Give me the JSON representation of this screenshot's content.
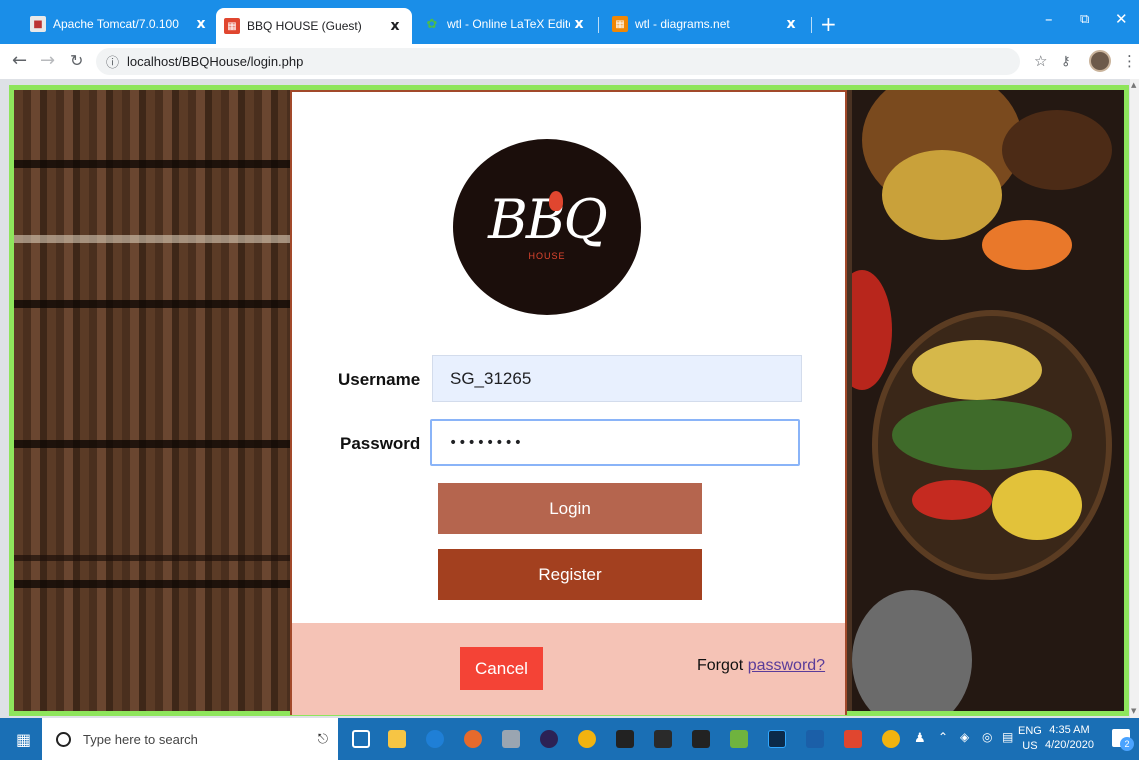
{
  "browser": {
    "tabs": [
      {
        "title": "Apache Tomcat/7.0.100",
        "favicon": "tomcat-icon",
        "active": false
      },
      {
        "title": "BBQ HOUSE (Guest)",
        "favicon": "bbq-icon",
        "active": true
      },
      {
        "title": "wtl - Online LaTeX Editor Overleaf",
        "favicon": "overleaf-icon",
        "active": false
      },
      {
        "title": "wtl - diagrams.net",
        "favicon": "drawio-icon",
        "active": false
      }
    ],
    "close_glyph": "x",
    "new_tab_glyph": "+",
    "url": "localhost/BBQHouse/login.php",
    "colors": {
      "tabstrip": "#1a8ee8",
      "page_border": "#8ee55c"
    }
  },
  "login": {
    "logo_text": "BBQ",
    "logo_subtext": "HOUSE",
    "username_label": "Username",
    "username_value": "SG_31265",
    "password_label": "Password",
    "password_value": "••••••••",
    "login_button": "Login",
    "register_button": "Register",
    "cancel_button": "Cancel",
    "forgot_text": "Forgot",
    "forgot_link": "password?",
    "colors": {
      "login": "#b5654e",
      "register": "#a3401f",
      "cancel": "#f44336",
      "footer": "#f5c3b6"
    }
  },
  "taskbar": {
    "search_placeholder": "Type here to search",
    "language_top": "ENG",
    "language_bottom": "US",
    "time": "4:35 AM",
    "date": "4/20/2020",
    "notification_count": "2"
  }
}
